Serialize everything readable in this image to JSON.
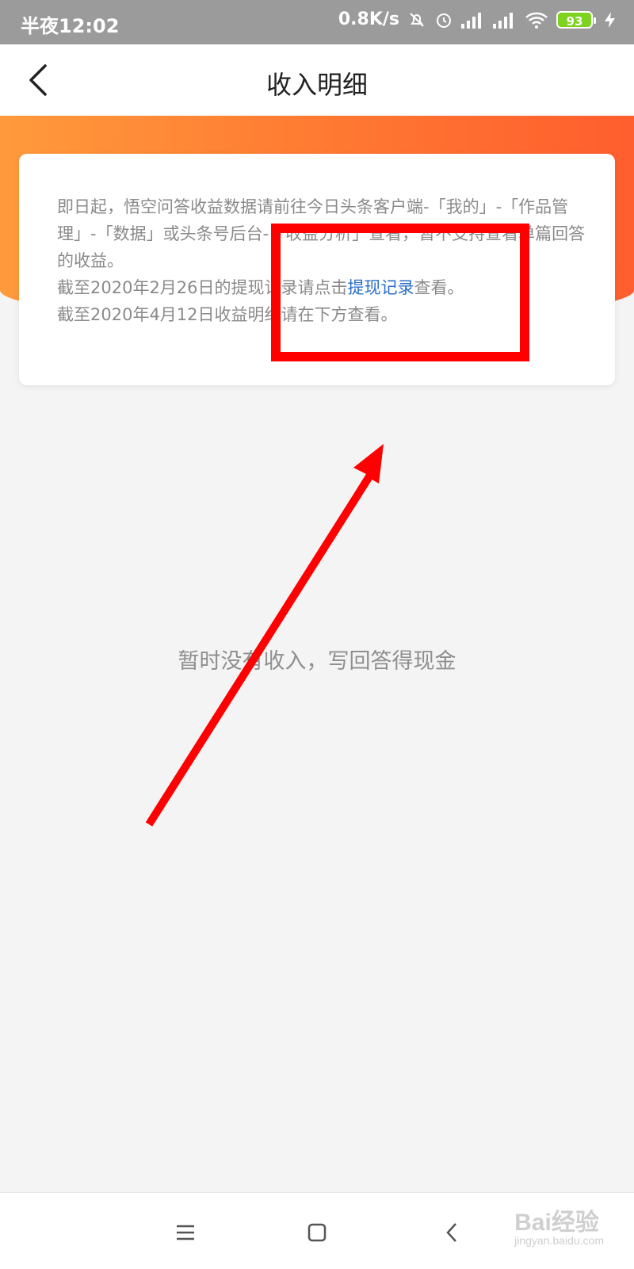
{
  "status_bar": {
    "time": "半夜12:02",
    "network_speed": "0.8K/s",
    "battery": "93",
    "icons": [
      "mute-icon",
      "alarm-icon",
      "signal-icon",
      "hd-signal-icon",
      "wifi-icon",
      "battery-icon",
      "charging-icon"
    ]
  },
  "header": {
    "title": "收入明细",
    "back_icon": "chevron-left-icon"
  },
  "notice": {
    "line1": "即日起，悟空问答收益数据请前往今日头条客户端-「我的」-「作品管理」-「数据」或头条号后台-「收益分析」查看，暂不支持查看单篇回答的收益。",
    "line2_prefix": "截至2020年2月26日的提现记录请点击",
    "line2_link": "提现记录",
    "line2_suffix": "查看。",
    "line3": "截至2020年4月12日收益明细请在下方查看。"
  },
  "empty_state": {
    "text": "暂时没有收入，写回答得现金"
  },
  "nav_bar": {
    "icons": [
      "menu-icon",
      "home-icon",
      "back-icon"
    ]
  },
  "watermark": {
    "brand": "Bai经验",
    "url": "jingyan.baidu.com"
  },
  "colors": {
    "accent_orange": "#ff7a32",
    "link_blue": "#2a6fc9",
    "annotation_red": "#ff0000"
  }
}
